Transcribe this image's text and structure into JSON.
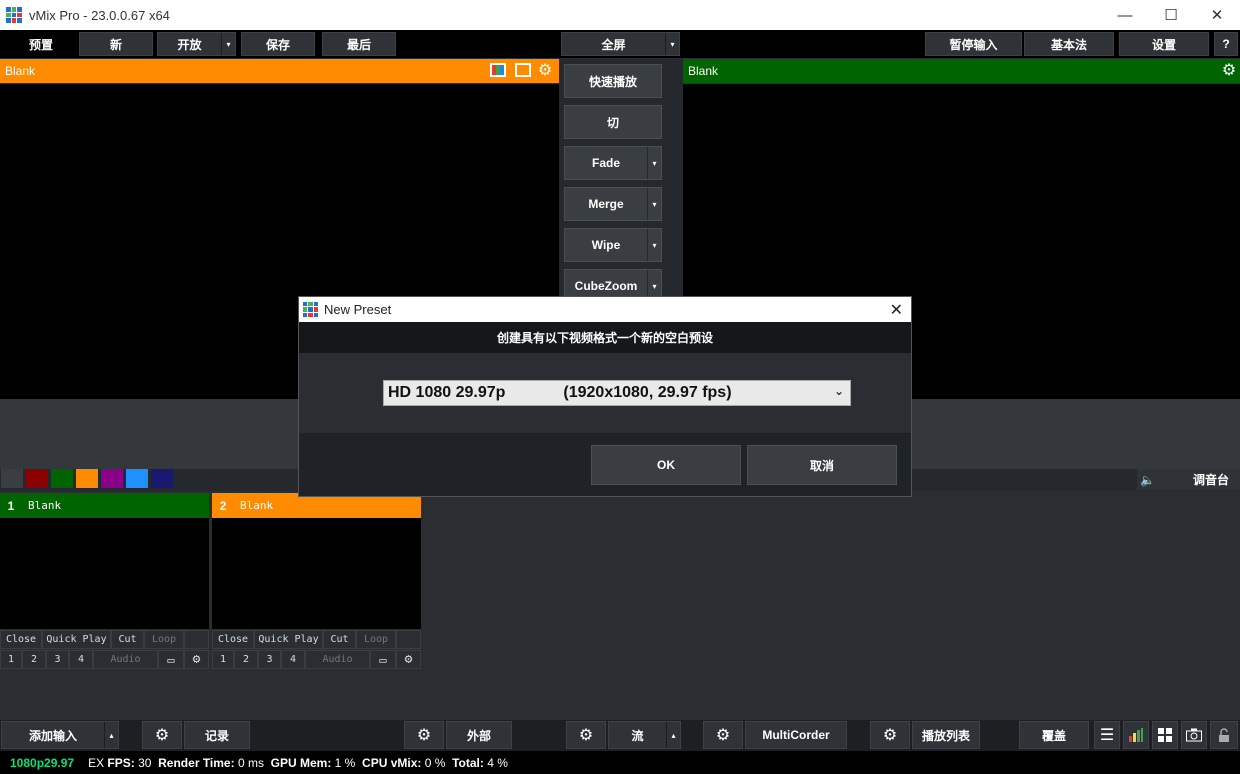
{
  "window": {
    "title": "vMix Pro - 23.0.0.67 x64",
    "min": "—",
    "max": "☐",
    "close": "✕"
  },
  "toolbar": {
    "preview_label": "预置",
    "new_label": "新",
    "open_label": "开放",
    "save_label": "保存",
    "last_label": "最后",
    "fullscreen_label": "全屏",
    "pause_input_label": "暂停输入",
    "basic_label": "基本法",
    "settings_label": "设置",
    "help_label": "?",
    "caret": "▾"
  },
  "preview": {
    "label": "Blank"
  },
  "output": {
    "label": "Blank"
  },
  "transitions": {
    "quick_play": "快速播放",
    "cut": "切",
    "fade": "Fade",
    "merge": "Merge",
    "wipe": "Wipe",
    "cubezoom": "CubeZoom",
    "caret": "▾"
  },
  "colors": {
    "preview": "#ff8c00",
    "output": "#006400",
    "swatches": [
      "#3a3e43",
      "#8b0000",
      "#006400",
      "#ff8c00",
      "#8b008b",
      "#1e90ff",
      "#191970"
    ]
  },
  "audio": {
    "speaker": "🔈",
    "mixer_label": "调音台"
  },
  "inputs": [
    {
      "number": "1",
      "name": "Blank",
      "color": "#006400",
      "close": "Close",
      "quick_play": "Quick Play",
      "cut": "Cut",
      "loop": "Loop",
      "slots": [
        "1",
        "2",
        "3",
        "4"
      ],
      "audio": "Audio"
    },
    {
      "number": "2",
      "name": "Blank",
      "color": "#ff8c00",
      "close": "Close",
      "quick_play": "Quick Play",
      "cut": "Cut",
      "loop": "Loop",
      "slots": [
        "1",
        "2",
        "3",
        "4"
      ],
      "audio": "Audio"
    }
  ],
  "bottom": {
    "add_input": "添加输入",
    "record": "记录",
    "external": "外部",
    "stream": "流",
    "multicorder": "MultiCorder",
    "playlist": "播放列表",
    "overlay": "覆盖",
    "caret": "▴"
  },
  "status": {
    "format": "1080p29.97",
    "ex": "EX",
    "fps_label": "FPS:",
    "fps_value": "30",
    "render_label": "Render Time:",
    "render_value": "0 ms",
    "gpu_label": "GPU Mem:",
    "gpu_value": "1 %",
    "cpu_label": "CPU vMix:",
    "cpu_value": "0 %",
    "total_label": "Total:",
    "total_value": "4 %"
  },
  "dialog": {
    "title": "New Preset",
    "close": "✕",
    "header": "创建具有以下视频格式一个新的空白预设",
    "format_name": "HD 1080 29.97p",
    "format_detail": "(1920x1080, 29.97 fps)",
    "chevron": "⌄",
    "ok_label": "OK",
    "cancel_label": "取消"
  }
}
